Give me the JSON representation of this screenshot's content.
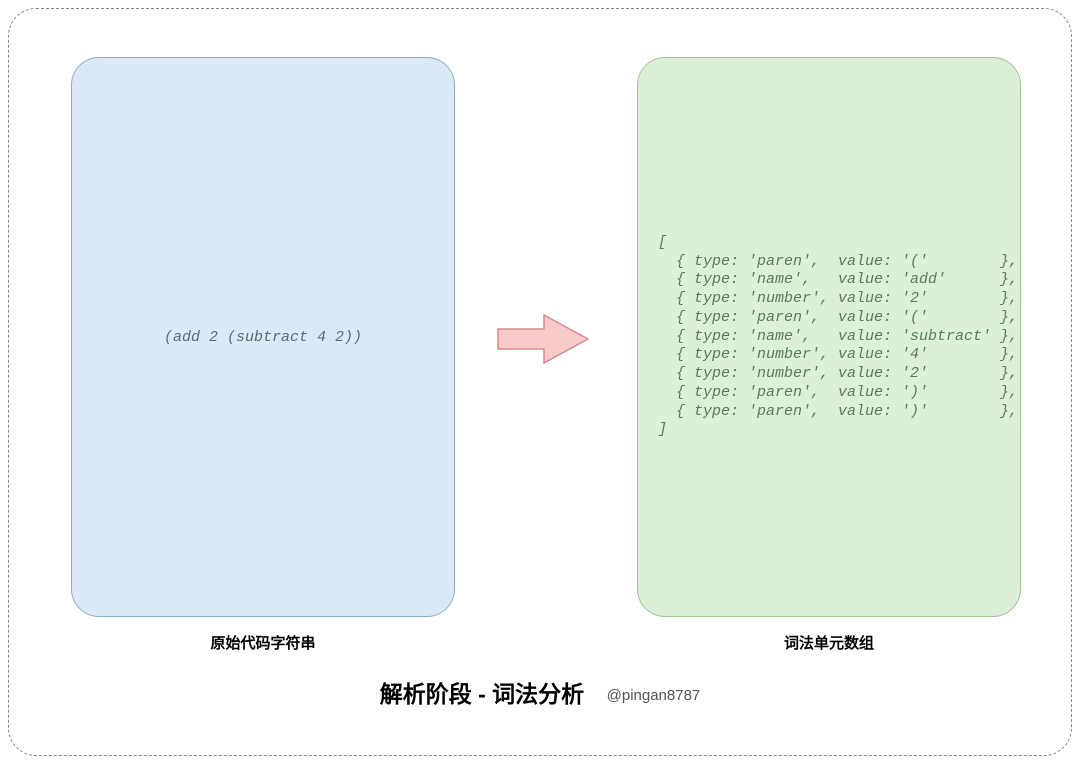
{
  "left": {
    "code": "(add 2 (subtract 4 2))",
    "label": "原始代码字符串"
  },
  "right": {
    "code": "[\n  { type: 'paren',  value: '('        },\n  { type: 'name',   value: 'add'      },\n  { type: 'number', value: '2'        },\n  { type: 'paren',  value: '('        },\n  { type: 'name',   value: 'subtract' },\n  { type: 'number', value: '4'        },\n  { type: 'number', value: '2'        },\n  { type: 'paren',  value: ')'        },\n  { type: 'paren',  value: ')'        },\n]",
    "label": "词法单元数组"
  },
  "title": {
    "main": "解析阶段 - 词法分析",
    "author": "@pingan8787"
  },
  "colors": {
    "leftBg": "#dbe9f6",
    "leftBorder": "#8faecc",
    "rightBg": "#dcefd7",
    "rightBorder": "#9fc894",
    "arrowFill": "#f7caca",
    "arrowStroke": "#d88a8a"
  }
}
